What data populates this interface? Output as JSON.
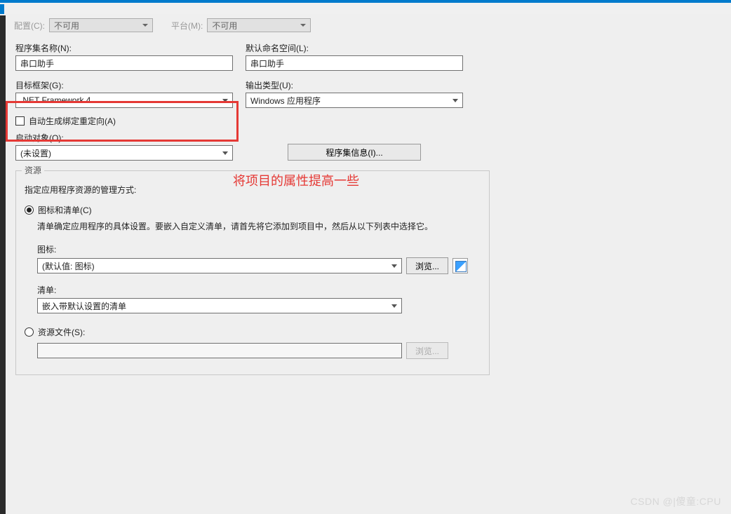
{
  "toolbar": {
    "config_label": "配置(C):",
    "config_value": "不可用",
    "platform_label": "平台(M):",
    "platform_value": "不可用"
  },
  "assembly": {
    "name_label": "程序集名称(N):",
    "name_value": "串口助手",
    "namespace_label": "默认命名空间(L):",
    "namespace_value": "串口助手"
  },
  "framework": {
    "label": "目标框架(G):",
    "value": ".NET Framework 4"
  },
  "output": {
    "label": "输出类型(U):",
    "value": "Windows 应用程序"
  },
  "auto_redirect": {
    "label": "自动生成绑定重定向(A)"
  },
  "startup": {
    "label": "启动对象(O):",
    "value": "(未设置)"
  },
  "assembly_info_btn": "程序集信息(I)...",
  "annotation": "将项目的属性提高一些",
  "resources": {
    "group_title": "资源",
    "subtitle": "指定应用程序资源的管理方式:",
    "icon_manifest_label": "图标和清单(C)",
    "icon_manifest_desc": "清单确定应用程序的具体设置。要嵌入自定义清单，请首先将它添加到项目中，然后从以下列表中选择它。",
    "icon_label": "图标:",
    "icon_value": "(默认值: 图标)",
    "browse_btn": "浏览...",
    "manifest_label": "清单:",
    "manifest_value": "嵌入带默认设置的清单",
    "resource_file_label": "资源文件(S):",
    "resource_file_browse": "浏览..."
  },
  "watermark": "CSDN @|傻童:CPU"
}
